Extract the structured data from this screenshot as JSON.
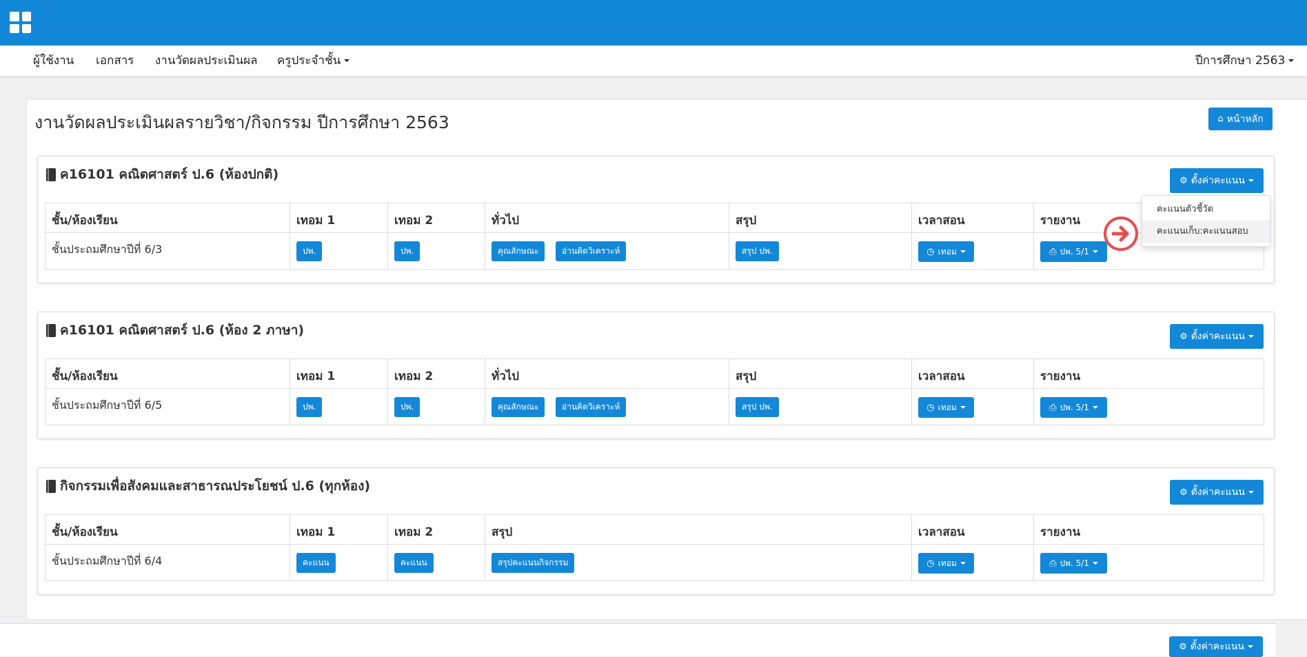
{
  "navbar": {
    "items": [
      "ผู้ใช้งาน",
      "เอกสาร",
      "งานวัดผลประเมินผล",
      "ครูประจำชั้น"
    ],
    "year": "ปีการศึกษา 2563"
  },
  "page": {
    "title": "งานวัดผลประเมินผลรายวิชา/กิจกรรม ปีการศึกษา 2563",
    "home_button": "หน้าหลัก"
  },
  "common": {
    "settings_button": "ตั้งค่าคะแนน",
    "headers": {
      "class": "ชั้น/ห้องเรียน",
      "term1": "เทอม 1",
      "term2": "เทอม 2",
      "general": "ทั่วไป",
      "summary": "สรุป",
      "schedule": "เวลาสอน",
      "report": "รายงาน"
    },
    "btn_pp": "ปพ.",
    "btn_character": "คุณลักษณะ",
    "btn_reading": "อ่านคิดวิเคราะห์",
    "btn_summary_pp": "สรุป ปพ.",
    "btn_term": "เทอม",
    "btn_report": "ปพ. 5/1",
    "btn_score": "คะแนน",
    "btn_summary_activity": "สรุปคะแนนกิจกรรม"
  },
  "cards": [
    {
      "title": "ค16101 คณิตศาสตร์ ป.6 (ห้องปกติ)",
      "class": "ชั้นประถมศึกษาปีที่ 6/3"
    },
    {
      "title": "ค16101 คณิตศาสตร์ ป.6 (ห้อง 2 ภาษา)",
      "class": "ชั้นประถมศึกษาปีที่ 6/5"
    },
    {
      "title": "กิจกรรมเพื่อสังคมและสาธารณประโยชน์ ป.6 (ทุกห้อง)",
      "class": "ชั้นประถมศึกษาปีที่ 6/4"
    }
  ],
  "dropdown": {
    "items": [
      "คะแนนตัวชี้วัด",
      "คะแนนเก็บ:คะแนนสอบ"
    ]
  }
}
